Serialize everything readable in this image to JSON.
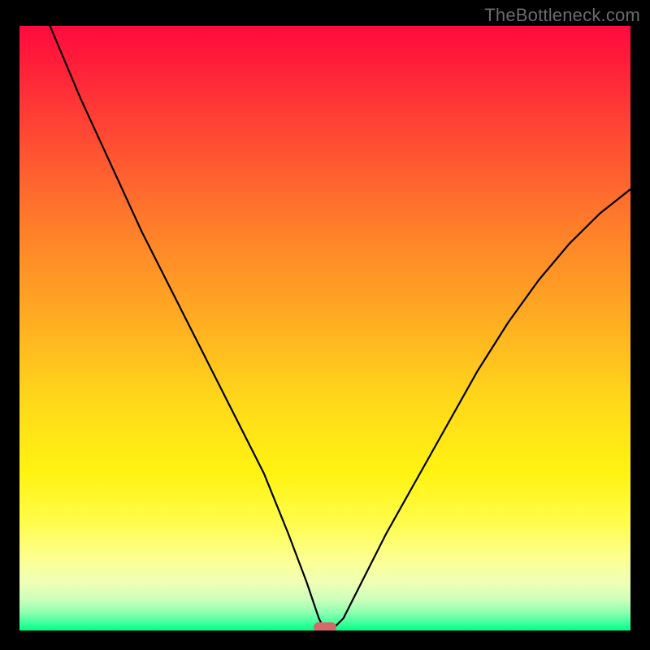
{
  "watermark": "TheBottleneck.com",
  "chart_data": {
    "type": "line",
    "title": "",
    "xlabel": "",
    "ylabel": "",
    "x_range": [
      0,
      100
    ],
    "y_range": [
      0,
      100
    ],
    "grid": false,
    "legend": false,
    "marker": {
      "x": 50,
      "y": 0,
      "color": "#d46a6a",
      "shape": "pill"
    },
    "series": [
      {
        "name": "curve",
        "color": "#000000",
        "x": [
          5,
          10,
          15,
          20,
          25,
          30,
          35,
          40,
          44,
          47,
          49,
          50,
          51,
          53,
          56,
          60,
          65,
          70,
          75,
          80,
          85,
          90,
          95,
          100
        ],
        "values": [
          100,
          88,
          77,
          66,
          56,
          46,
          36,
          26,
          16,
          8,
          2,
          0,
          0,
          2,
          8,
          16,
          25,
          34,
          43,
          51,
          58,
          64,
          69,
          73
        ]
      }
    ]
  }
}
